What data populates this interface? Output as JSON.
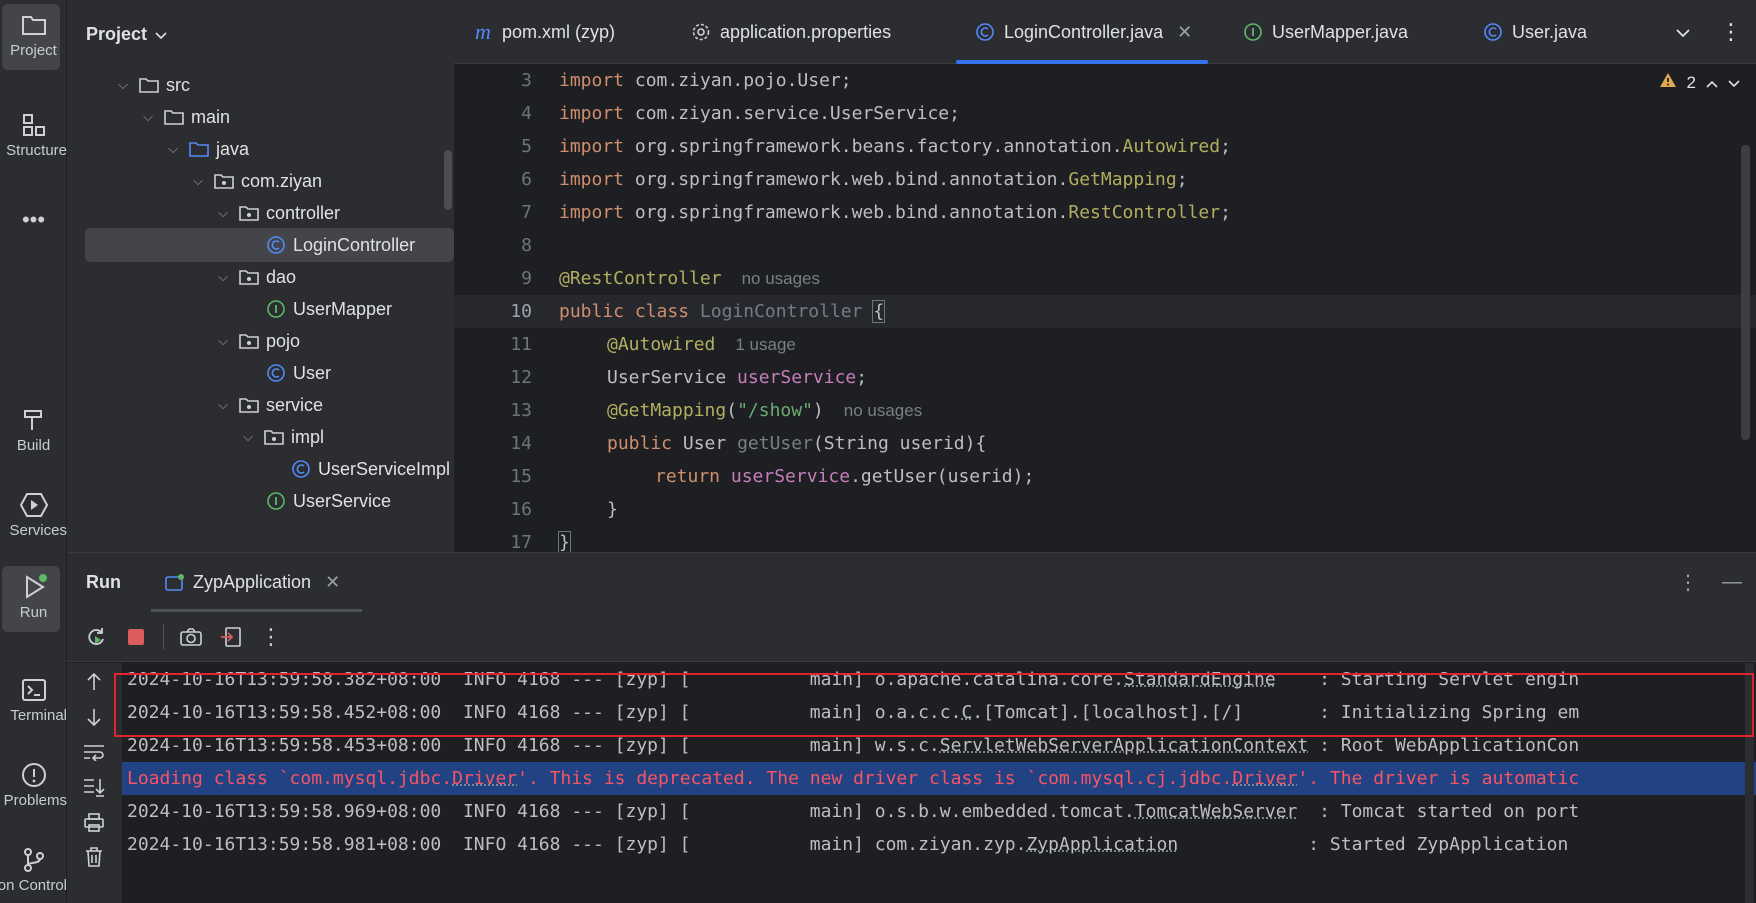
{
  "toolstrip": {
    "items": [
      {
        "label": "Project",
        "icon": "folder-icon"
      },
      {
        "label": "Structure",
        "icon": "structure-icon"
      },
      {
        "label": "",
        "icon": "more-icon"
      },
      {
        "label": "Build",
        "icon": "hammer-icon"
      },
      {
        "label": "Services",
        "icon": "services-icon"
      },
      {
        "label": "Run",
        "icon": "run-icon"
      },
      {
        "label": "Terminal",
        "icon": "terminal-icon"
      },
      {
        "label": "Problems",
        "icon": "problems-icon"
      },
      {
        "label": "Version Control",
        "icon": "git-icon"
      }
    ]
  },
  "project": {
    "title": "Project",
    "tree": [
      {
        "label": "src",
        "type": "folder"
      },
      {
        "label": "main",
        "type": "folder"
      },
      {
        "label": "java",
        "type": "source-folder"
      },
      {
        "label": "com.ziyan",
        "type": "package"
      },
      {
        "label": "controller",
        "type": "package"
      },
      {
        "label": "LoginController",
        "type": "class"
      },
      {
        "label": "dao",
        "type": "package"
      },
      {
        "label": "UserMapper",
        "type": "interface"
      },
      {
        "label": "pojo",
        "type": "package"
      },
      {
        "label": "User",
        "type": "class"
      },
      {
        "label": "service",
        "type": "package"
      },
      {
        "label": "impl",
        "type": "package"
      },
      {
        "label": "UserServiceImpl",
        "type": "class"
      },
      {
        "label": "UserService",
        "type": "interface"
      }
    ]
  },
  "editor": {
    "tabs": [
      {
        "label": "pom.xml (zyp)",
        "icon": "maven-icon"
      },
      {
        "label": "application.properties",
        "icon": "settings-icon"
      },
      {
        "label": "LoginController.java",
        "icon": "class-icon",
        "active": true
      },
      {
        "label": "UserMapper.java",
        "icon": "interface-icon"
      },
      {
        "label": "User.java",
        "icon": "class-icon"
      }
    ],
    "warnings_count": "2",
    "line_numbers": [
      "3",
      "4",
      "5",
      "6",
      "7",
      "8",
      "9",
      "10",
      "11",
      "12",
      "13",
      "14",
      "15",
      "16",
      "17"
    ],
    "code": {
      "l3": [
        "import",
        " com.ziyan.pojo.User;"
      ],
      "l4": [
        "import",
        " com.ziyan.service.UserService;"
      ],
      "l5": [
        "import",
        " org.springframework.beans.factory.annotation.",
        "Autowired",
        ";"
      ],
      "l6": [
        "import",
        " org.springframework.web.bind.annotation.",
        "GetMapping",
        ";"
      ],
      "l7": [
        "import",
        " org.springframework.web.bind.annotation.",
        "RestController",
        ";"
      ],
      "l9": [
        "@RestController",
        "no usages"
      ],
      "l10": [
        "public",
        " ",
        "class",
        " ",
        "LoginController",
        " ",
        "{"
      ],
      "l11": [
        "@Autowired",
        "1 usage"
      ],
      "l12": [
        "UserService ",
        "userService",
        ";"
      ],
      "l13": [
        "@GetMapping",
        "(",
        "\"/show\"",
        ")",
        "no usages"
      ],
      "l14": [
        "public",
        " User ",
        "getUser",
        "(String userid){"
      ],
      "l15": [
        "return",
        " ",
        "userService",
        ".getUser(userid);"
      ],
      "l16": [
        "}"
      ],
      "l17": [
        "}"
      ]
    }
  },
  "run": {
    "title": "Run",
    "tab_label": "ZypApplication",
    "console": [
      {
        "a": "2024-10-16T13:59:58.382+08:00  INFO 4168 --- [zyp] [           main] o.apache.catalina.core.",
        "u": "StandardEngine",
        "b": "    : Starting Servlet engin"
      },
      {
        "a": "2024-10-16T13:59:58.452+08:00  INFO 4168 --- [zyp] [           main] o.a.c.c.",
        "u": "C",
        "b": ".[Tomcat].[localhost].[/]       : Initializing Spring em"
      },
      {
        "a": "2024-10-16T13:59:58.453+08:00  INFO 4168 --- [zyp] [           main] w.s.c.",
        "u": "ServletWebServerApplicationContext",
        "b": " : Root WebApplicationCon"
      },
      {
        "err": true,
        "p1": "Loading class `com.mysql.jdbc.",
        "u1": "Driver",
        "p2": "'. This is deprecated. The new driver class is `com.mysql.cj.jdbc.",
        "u2": "Driver",
        "p3": "'. The driver is automatic"
      },
      {
        "a": "2024-10-16T13:59:58.969+08:00  INFO 4168 --- [zyp] [           main] o.s.b.w.embedded.tomcat.",
        "u": "TomcatWebServer",
        "b": "  : Tomcat started on port"
      },
      {
        "a": "2024-10-16T13:59:58.981+08:00  INFO 4168 --- [zyp] [           main] com.ziyan.zyp.",
        "u": "ZypApplication",
        "b": "            : Started ZypApplication"
      }
    ]
  },
  "colors": {
    "accent": "#3574f0",
    "highlight_box": "#e0242b",
    "error_text": "#f75464",
    "selection_bg": "#214283"
  }
}
